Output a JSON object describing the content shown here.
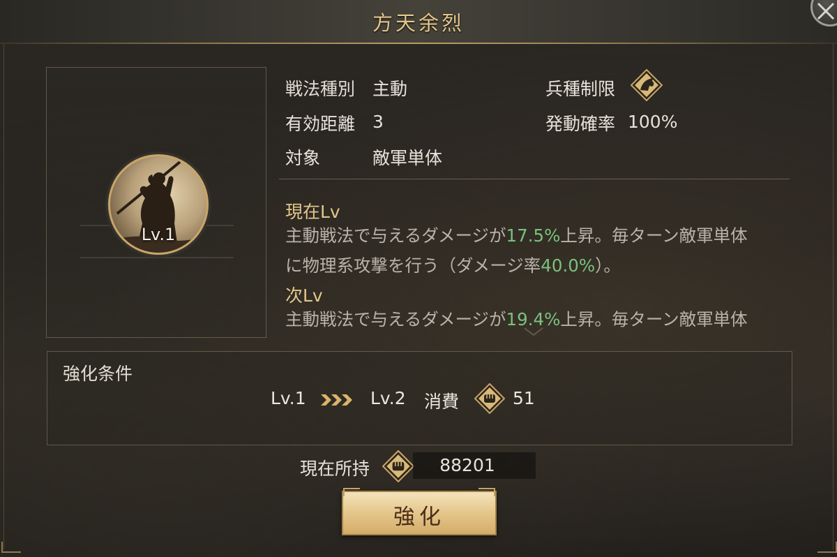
{
  "dialog": {
    "title": "方天余烈"
  },
  "skill": {
    "level": "Lv.1"
  },
  "info": {
    "type_label": "戦法種別",
    "type_value": "主動",
    "unit_label": "兵種制限",
    "range_label": "有効距離",
    "range_value": "3",
    "rate_label": "発動確率",
    "rate_value": "100%",
    "target_label": "対象",
    "target_value": "敵軍単体"
  },
  "current": {
    "header": "現在Lv",
    "line1_a": "主動戦法で与えるダメージが",
    "line1_pct": "17.5%",
    "line1_b": "上昇。毎ターン敵軍単体",
    "line2_a": "に物理系攻撃を行う（ダメージ率",
    "line2_pct": "40.0%",
    "line2_b": "）。"
  },
  "next": {
    "header": "次Lv",
    "line1_a": "主動戦法で与えるダメージが",
    "line1_pct": "19.4%",
    "line1_b": "上昇。毎ターン敵軍単体"
  },
  "upgrade": {
    "title": "強化条件",
    "from_level": "Lv.1",
    "to_level": "Lv.2",
    "cost_label": "消費",
    "cost_value": "51"
  },
  "owned": {
    "label": "現在所持",
    "value": "88201"
  },
  "button": {
    "enhance_label": "強化"
  },
  "colors": {
    "accent_gold": "#e3c78a",
    "highlight_green": "#7bc17e"
  }
}
